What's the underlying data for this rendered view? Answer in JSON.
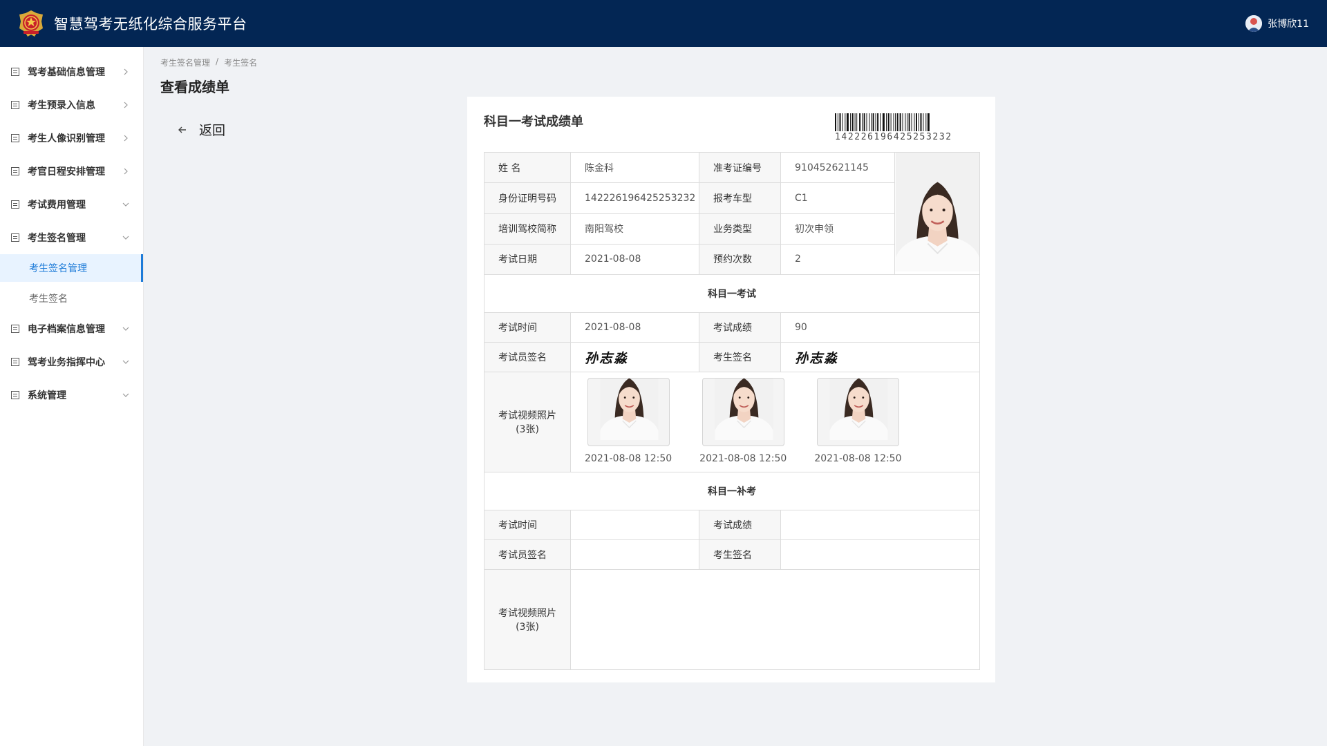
{
  "app": {
    "title": "智慧驾考无纸化综合服务平台",
    "user_name": "张博欣11"
  },
  "sidebar": {
    "items": [
      {
        "label": "驾考基础信息管理",
        "arrow": "chevron-right-icon"
      },
      {
        "label": "考生预录入信息",
        "arrow": "chevron-right-icon"
      },
      {
        "label": "考生人像识别管理",
        "arrow": "chevron-right-icon"
      },
      {
        "label": "考官日程安排管理",
        "arrow": "chevron-right-icon"
      },
      {
        "label": "考试费用管理",
        "arrow": "chevron-down-icon"
      },
      {
        "label": "考生签名管理",
        "arrow": "chevron-down-icon"
      },
      {
        "label": "电子档案信息管理",
        "arrow": "chevron-down-icon"
      },
      {
        "label": "驾考业务指挥中心",
        "arrow": "chevron-down-icon"
      },
      {
        "label": "系统管理",
        "arrow": "chevron-down-icon"
      }
    ],
    "sub_items": [
      {
        "label": "考生签名管理",
        "active": true
      },
      {
        "label": "考生签名",
        "active": false
      }
    ]
  },
  "breadcrumb": {
    "items": [
      "考生签名管理",
      "考生签名"
    ],
    "separator": "/"
  },
  "page": {
    "title": "查看成绩单",
    "back_label": "返回"
  },
  "report": {
    "title": "科目一考试成绩单",
    "barcode_number": "142226196425253232",
    "info": {
      "name_label": "姓 名",
      "name": "陈金科",
      "ticket_label": "准考证编号",
      "ticket": "910452621145",
      "id_label": "身份证明号码",
      "id_number": "142226196425253232",
      "vehicle_label": "报考车型",
      "vehicle": "C1",
      "school_label": "培训驾校简称",
      "school": "南阳驾校",
      "business_label": "业务类型",
      "business": "初次申领",
      "date_label": "考试日期",
      "date": "2021-08-08",
      "appointments_label": "预约次数",
      "appointments": "2"
    },
    "exam1": {
      "section_title": "科目一考试",
      "time_label": "考试时间",
      "time": "2021-08-08",
      "score_label": "考试成绩",
      "score": "90",
      "examiner_sig_label": "考试员签名",
      "examiner_sig": "孙志淼",
      "student_sig_label": "考生签名",
      "student_sig": "孙志淼",
      "photos_label": "考试视频照片",
      "photos_count": "(3张)",
      "photos": [
        {
          "time": "2021-08-08 12:50"
        },
        {
          "time": "2021-08-08 12:50"
        },
        {
          "time": "2021-08-08 12:50"
        }
      ]
    },
    "exam2": {
      "section_title": "科目一补考",
      "time_label": "考试时间",
      "time": "",
      "score_label": "考试成绩",
      "score": "",
      "examiner_sig_label": "考试员签名",
      "examiner_sig": "",
      "student_sig_label": "考生签名",
      "student_sig": "",
      "photos_label": "考试视频照片",
      "photos_count": "(3张)"
    }
  },
  "colors": {
    "header_bg": "#032654",
    "active": "#1d7bd8",
    "active_bg": "#e8f3ff"
  }
}
